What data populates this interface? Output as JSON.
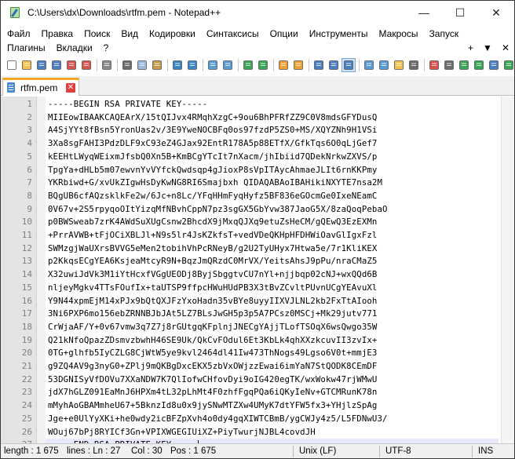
{
  "window": {
    "title": "C:\\Users\\dx\\Downloads\\rtfm.pem - Notepad++",
    "controls": {
      "minimize": "—",
      "maximize": "☐",
      "close": "✕"
    }
  },
  "menu": {
    "row1": [
      "Файл",
      "Правка",
      "Поиск",
      "Вид",
      "Кодировки",
      "Синтаксисы",
      "Опции",
      "Инструменты",
      "Макросы",
      "Запуск"
    ],
    "row2": [
      "Плагины",
      "Вкладки",
      "?"
    ],
    "right": {
      "add": "+",
      "dropdown": "▼",
      "close": "✕"
    }
  },
  "toolbar": {
    "icons": [
      "new-file-icon",
      "open-file-icon",
      "save-icon",
      "save-all-icon",
      "close-icon",
      "close-all-icon",
      "print-icon",
      "cut-icon",
      "copy-icon",
      "paste-icon",
      "undo-icon",
      "redo-icon",
      "find-icon",
      "replace-icon",
      "zoom-in-icon",
      "zoom-out-icon",
      "sync-vertical-icon",
      "sync-horizontal-icon",
      "word-wrap-icon",
      "show-all-chars-icon",
      "indent-guide-icon",
      "document-map-icon",
      "function-list-icon",
      "folder-workspace-icon",
      "monitoring-icon",
      "record-macro-icon",
      "stop-macro-icon",
      "play-macro-icon",
      "run-macro-multiple-icon",
      "save-macro-icon",
      "spell-check-icon"
    ]
  },
  "tab": {
    "label": "rtfm.pem",
    "close": "✕"
  },
  "editor": {
    "lines": [
      "-----BEGIN RSA PRIVATE KEY-----",
      "MIIEowIBAAKCAQEArX/15tQIJvx4RMqhXzgC+9ou6BhPFRfZZ9C0V8mdsGFYDusQ",
      "A4SjYYt8fBsn5YronUas2v/3E9YweNOCBFq0os97fzdP5ZS0+MS/XQYZNh9H1VSi",
      "3Xa8sgFAHI3PdzDLF9xC93eZ4GJax92EntR178A5p88ETfX/GfkTqs6O0qLjGef7",
      "kEEHtLWyqWEixmJfsbQ0Xn5B+KmBCgYTcIt7nXacm/jhIbiid7QDekNrkwZXVS/p",
      "TpgYa+dHLb5m07ewvnYvVYfckQwdsqp4gJioxP8sVpITAycAhmaeJLIt6rnKKPmy",
      "YKRbiwd+G/xvUkZIgwHsDyKwNG8RI6Smajbxh QIDAQABAoIBAHikiNXYTE7nsa2M",
      "BQgUB6cfAQzsklkFe2w/6Jc+n8Lc/YFqHHmFyqHyfz5BF836eGOcmGe0IxeNEamC",
      "0V67v+2S5rpyqoOItYizqMfNBvhCppN7pz3sgGX5GbYvw387JaoG5X/8zaQoqPebaO",
      "p0BWSweab7zrK4AWdSuXUgCsnw2BhcdX9jMxqQJXq9etuZsHeCM/gQEwQ3EzEXMn",
      "+PrrAVWB+tFjOCiXBLJl+N9s5lr4JsKZkfsT+vedVDeQKHpHFDHWiOavGlIgxFzl",
      "SWMzgjWaUXrsBVVG5eMen2tobihVhPcRNeyB/g2U2TyUHyx7Htwa5e/7r1KliKEX",
      "p2KkqsECgYEA6KsjeaMtcyR9N+BqzJmQRzdC0MrVX/YeitsAhsJ9pPu/nraCMaZ5",
      "X32uwiJdVk3M1iYtHcxfVGgUEODj8ByjSbggtvCU7nYl+njjbqp02cNJ+wxQQd6B",
      "nljeyMgkv4TTsFOufIx+taUTSP9ffpcHWuHUdPB3X3tBvZCvltPUvnUCgYEAvuXl",
      "Y9N44xpmEjM14xPJx9bQtQXJFzYxoHadn35vBYe8uyyIIXVJLNL2kb2FxTtAIooh",
      "3Ni6PXP6mo156ebZRNNBJbJAt5LZ7BLsJwGH5p3p5A7PCsz0MSCj+Mk29jutv771",
      "CrWjaAF/Y+0v67vmw3q7Z7j8rGUtgqKFplnjJNECgYAjjTLofTSOqX6wsQwgo35W",
      "Q21kNfoQpazZDsmvzbwhH46SE9Uk/QkCvFOdul6Et3KbLk4qhXXzkcuvII3zvIx+",
      "0TG+glhfb5IyCZLG8CjWtW5ye9kvl2464dl41Iw473ThNogs49Lgso6V0t+mmjE3",
      "g9ZQ4AV9g3nyG0+ZPlj9mQKBgDxcEKX5zbVxOWjzzEwai6imYaN7StQODK8CEmDF",
      "53DGNISyVfDOVu7XXaNDW7K7QlIofwCHfovDyi9oIG420egTK/wxWokw47rjWMwU",
      "jdX7hGLZ091EaMnJ6HPXm4tL32pLhMt4F0zhfFgqPQa6iQKyIeNv+GTCMRunK78n",
      "mMyhAoGBAMmheU67+5BknzId8u0x9jySNwMTZXw4UMyK7dtYFW5fx3+YHjlzSpAg",
      "Jge+e0UlYyXKi+he0wdy2icBFZpXvh4o0dy4gqXIWTCBmB/ygCWJy4z5/L5FDNwU3/",
      "WOuj67bPj8RYICf3Gn+VPIXWGEGIUiXZ+PiyTwurjNJBL4covdJH",
      "-----END RSA PRIVATE KEY-----"
    ],
    "caret_line": 27
  },
  "status": {
    "length": "length : 1 675",
    "lines": "lines : Ln : 27",
    "col": "Col : 30",
    "pos": "Pos : 1 675",
    "eol": "Unix (LF)",
    "encoding": "UTF-8",
    "mode": "INS"
  }
}
